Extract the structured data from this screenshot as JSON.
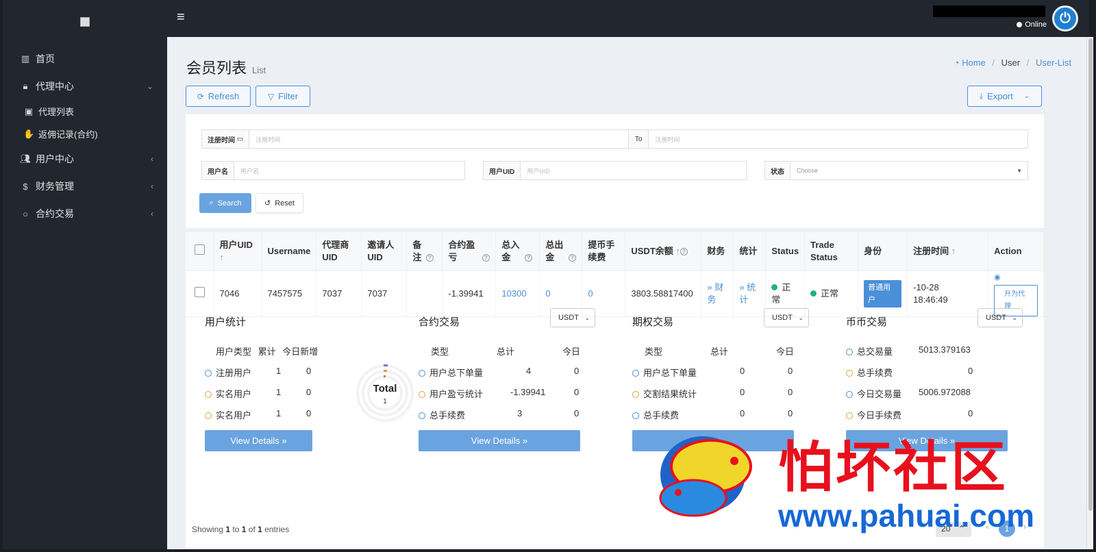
{
  "sidebar": {
    "items": [
      {
        "label": "首页",
        "icon": "bar-chart-icon"
      },
      {
        "label": "代理中心",
        "icon": "lock-icon"
      },
      {
        "label": "代理列表",
        "icon": "id-card-icon"
      },
      {
        "label": "返佣记录(合约)",
        "icon": "hand-coin-icon"
      },
      {
        "label": "用户中心",
        "icon": "users-icon"
      },
      {
        "label": "财务管理",
        "icon": "dollar-icon"
      },
      {
        "label": "合约交易",
        "icon": "circle-icon"
      }
    ]
  },
  "header": {
    "menu_icon": "≡",
    "status": "Online"
  },
  "page": {
    "title": "会员列表",
    "subtitle": "List",
    "breadcrumb": [
      "Home",
      "User",
      "User-List"
    ]
  },
  "toolbar": {
    "refresh": "Refresh",
    "filter": "Filter",
    "export": "Export"
  },
  "filters": {
    "reg_time_label": "注册时间",
    "reg_time_placeholder": "注册时间",
    "to_label": "To",
    "reg_time_to_placeholder": "注册时间",
    "username_label": "用户名",
    "username_placeholder": "用户名",
    "uid_label": "用户UID",
    "uid_placeholder": "用户UID",
    "status_label": "状态",
    "status_value": "Choose",
    "search": "Search",
    "reset": "Reset"
  },
  "table": {
    "headers": {
      "uid": "用户UID",
      "username": "Username",
      "agent_uid": "代理商UID",
      "inviter_uid": "邀请人UID",
      "remark": "备注",
      "pnl": "合约盈亏",
      "deposit": "总入金",
      "withdraw": "总出金",
      "fee": "提币手续费",
      "usdt": "USDT余额",
      "finance": "财务",
      "stats": "统计",
      "status": "Status",
      "trade_status": "Trade Status",
      "role": "身份",
      "reg_time": "注册时间",
      "action": "Action"
    },
    "row": {
      "uid": "7046",
      "username": "7457575",
      "agent_uid": "7037",
      "inviter_uid": "7037",
      "remark": "",
      "pnl": "-1.39941",
      "deposit": "10300",
      "withdraw": "0",
      "fee": "0",
      "usdt": "3803.58817400",
      "finance": "» 财务",
      "stats": "» 统计",
      "status": "正常",
      "trade_status": "正常",
      "role": "普通用户",
      "reg_time": "-10-28 18:46:49",
      "action_btn": "升为代理"
    }
  },
  "stats": {
    "user": {
      "title": "用户统计",
      "col1": "用户类型",
      "col2": "累计",
      "col3": "今日新增",
      "rows": [
        {
          "name": "注册用户",
          "total": "1",
          "today": "0"
        },
        {
          "name": "实名用户",
          "total": "1",
          "today": "0"
        },
        {
          "name": "实名用户",
          "total": "1",
          "today": "0"
        }
      ],
      "donut_label": "Total",
      "donut_value": "1",
      "btn": "View Details »"
    },
    "contract": {
      "title": "合约交易",
      "currency": "USDT",
      "col1": "类型",
      "col2": "总计",
      "col3": "今日",
      "rows": [
        {
          "name": "用户总下单量",
          "total": "4",
          "today": "0"
        },
        {
          "name": "用户盈亏统计",
          "total": "-1.39941",
          "today": "0"
        },
        {
          "name": "总手续费",
          "total": "3",
          "today": "0"
        }
      ],
      "btn": "View Details »"
    },
    "option": {
      "title": "期权交易",
      "currency": "USDT",
      "col1": "类型",
      "col2": "总计",
      "col3": "今日",
      "rows": [
        {
          "name": "用户总下单量",
          "total": "0",
          "today": "0"
        },
        {
          "name": "交割结果统计",
          "total": "0",
          "today": "0"
        },
        {
          "name": "总手续费",
          "total": "0",
          "today": "0"
        }
      ]
    },
    "coin": {
      "title": "币币交易",
      "currency": "USDT",
      "rows": [
        {
          "name": "总交易量",
          "value": "5013.379163"
        },
        {
          "name": "总手续费",
          "value": "0"
        },
        {
          "name": "今日交易量",
          "value": "5006.972088"
        },
        {
          "name": "今日手续费",
          "value": "0"
        }
      ],
      "btn": "View Details »"
    }
  },
  "footer": {
    "showing": "Showing",
    "from": "1",
    "to_word": "to",
    "to": "1",
    "of_word": "of",
    "total": "1",
    "entries": "entries",
    "page_size": "20",
    "current_page": "1"
  },
  "watermark": {
    "text": "怕坏社区",
    "url": "www.pahuai.com"
  }
}
